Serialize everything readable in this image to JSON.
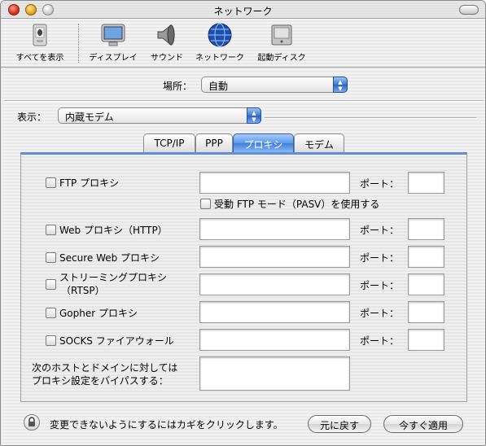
{
  "window": {
    "title": "ネットワーク"
  },
  "toolbar": {
    "items": [
      {
        "label": "すべてを表示",
        "icon": "show-all-icon"
      },
      {
        "label": "ディスプレイ",
        "icon": "display-icon"
      },
      {
        "label": "サウンド",
        "icon": "sound-icon"
      },
      {
        "label": "ネットワーク",
        "icon": "network-globe-icon"
      },
      {
        "label": "起動ディスク",
        "icon": "startup-disk-icon"
      }
    ]
  },
  "location": {
    "label": "場所：",
    "value": "自動"
  },
  "show": {
    "label": "表示：",
    "value": "内蔵モデム"
  },
  "tabs": [
    {
      "label": "TCP/IP",
      "active": false
    },
    {
      "label": "PPP",
      "active": false
    },
    {
      "label": "プロキシ",
      "active": true
    },
    {
      "label": "モデム",
      "active": false
    }
  ],
  "proxies": {
    "port_label": "ポート：",
    "rows": [
      {
        "label": "FTP プロキシ",
        "checked": false,
        "server": "",
        "port": ""
      },
      {
        "label": "Web プロキシ（HTTP）",
        "checked": false,
        "server": "",
        "port": ""
      },
      {
        "label": "Secure Web プロキシ",
        "checked": false,
        "server": "",
        "port": ""
      },
      {
        "label_line1": "ストリーミングプロキシ",
        "label_line2": "（RTSP）",
        "checked": false,
        "server": "",
        "port": ""
      },
      {
        "label": "Gopher プロキシ",
        "checked": false,
        "server": "",
        "port": ""
      },
      {
        "label": "SOCKS ファイアウォール",
        "checked": false,
        "server": "",
        "port": ""
      }
    ],
    "passive_ftp": {
      "label": "受動 FTP モード（PASV）を使用する",
      "checked": false
    },
    "bypass": {
      "line1": "次のホストとドメインに対しては",
      "line2": "プロキシ設定をバイパスする：",
      "value": ""
    }
  },
  "footer": {
    "lock_text": "変更できないようにするにはカギをクリックします。",
    "revert_label": "元に戻す",
    "apply_label": "今すぐ適用"
  },
  "colors": {
    "accent": "#3f7fdc",
    "tab_rule": "#5f8fd8"
  }
}
